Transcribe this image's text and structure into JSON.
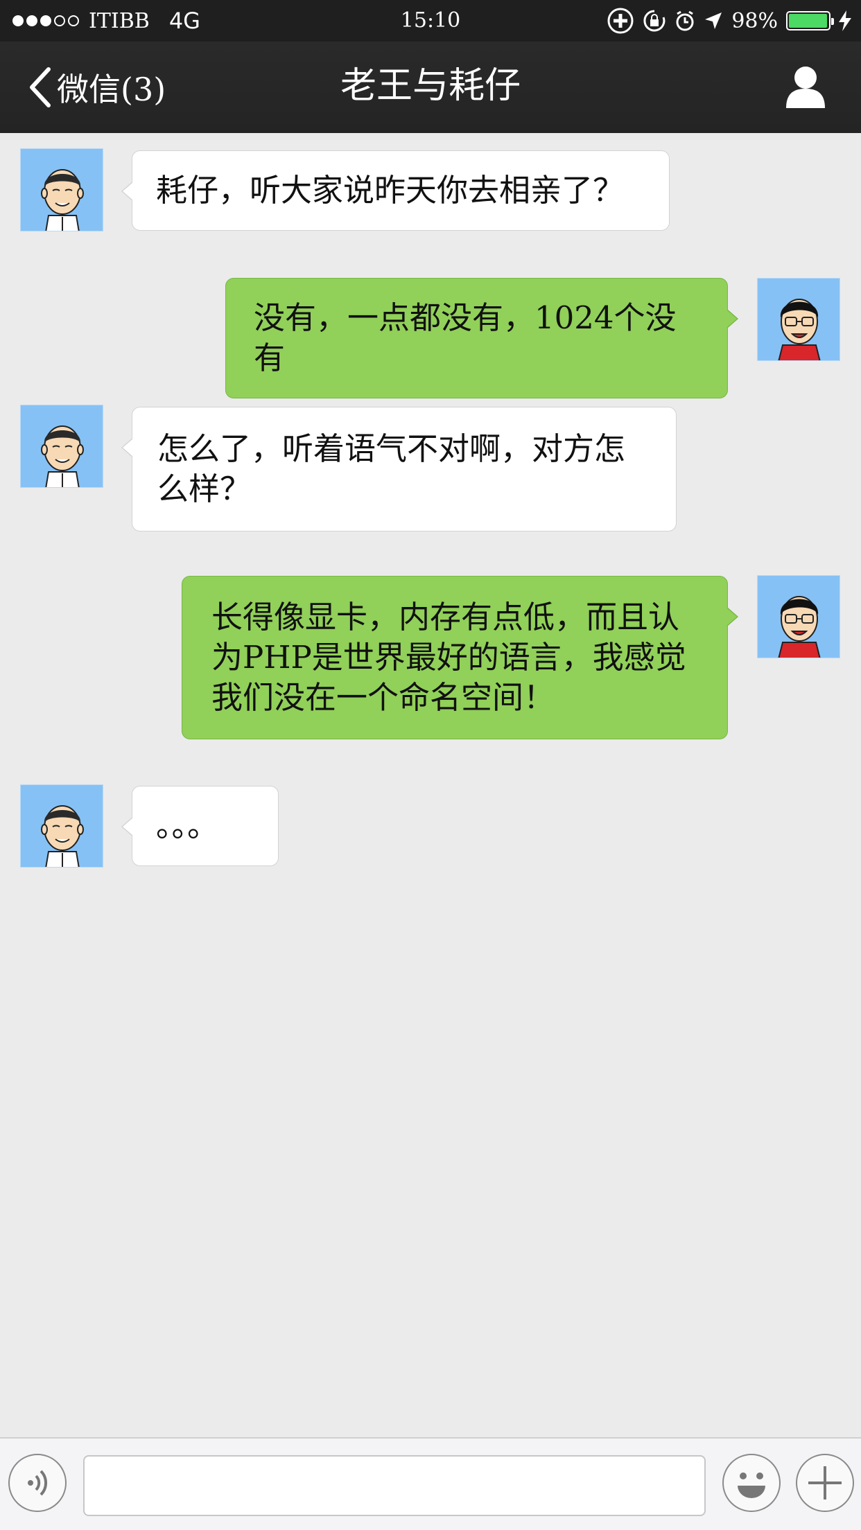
{
  "status_bar": {
    "carrier": "ITIBB",
    "network": "4G",
    "time": "15:10",
    "battery_percent": "98%",
    "battery_level": 0.98,
    "battery_color": "#4cd964"
  },
  "nav": {
    "back_label": "微信(3)",
    "title": "老王与耗仔"
  },
  "messages": [
    {
      "sender": "老王",
      "direction": "incoming",
      "text": "耗仔，听大家说昨天你去相亲了？"
    },
    {
      "sender": "耗仔",
      "direction": "outgoing",
      "text": "没有，一点都没有，1024个没有"
    },
    {
      "sender": "老王",
      "direction": "incoming",
      "text": "怎么了，听着语气不对啊，对方怎么样？"
    },
    {
      "sender": "耗仔",
      "direction": "outgoing",
      "text": "长得像显卡，内存有点低，而且认为PHP是世界最好的语言，我感觉我们没在一个命名空间！"
    },
    {
      "sender": "老王",
      "direction": "incoming",
      "text": "。。。"
    }
  ],
  "input_bar": {
    "text_value": "",
    "icons": [
      "voice-icon",
      "emoji-icon",
      "plus-icon"
    ]
  },
  "colors": {
    "outgoing_bubble": "#91d059",
    "incoming_bubble": "#ffffff",
    "avatar_bg": "#85c1f5",
    "nav_bg": "#242424",
    "chat_bg": "#ebebeb"
  }
}
